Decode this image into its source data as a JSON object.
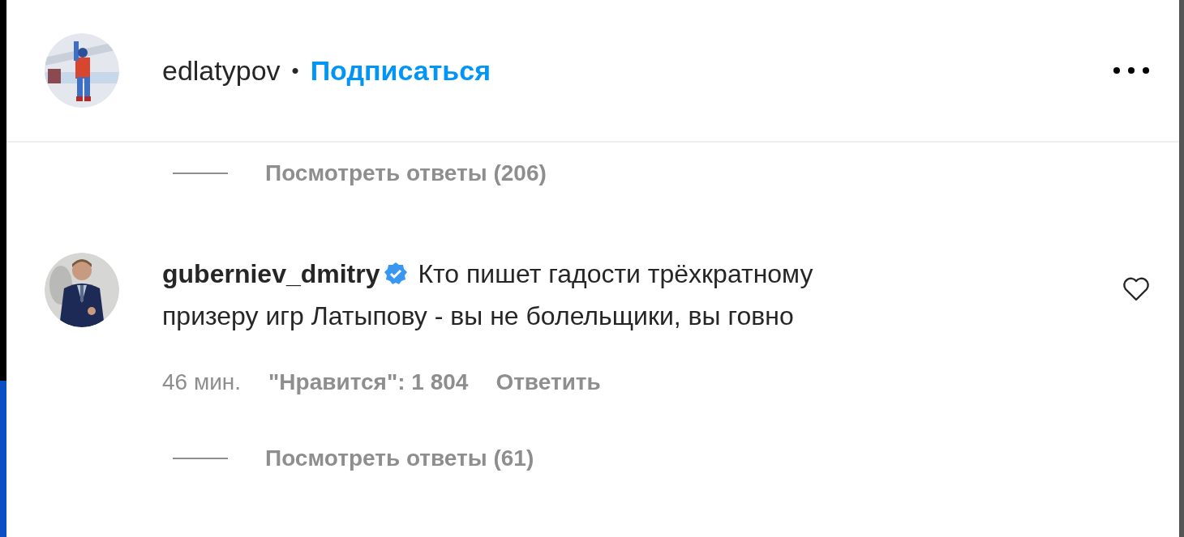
{
  "post_header": {
    "username": "edlatypov",
    "separator": "•",
    "follow": "Подписаться"
  },
  "comments": [
    {
      "kind": "replies",
      "label": "Посмотреть ответы (206)"
    },
    {
      "kind": "comment",
      "username": "guberniev_dmitry",
      "verified": true,
      "text": "Кто пишет гадости трёхкратному призеру игр Латыпову - вы не болельщики, вы говно",
      "time": "46 мин.",
      "likes": "\"Нравится\": 1 804",
      "reply": "Ответить",
      "liked": false
    },
    {
      "kind": "replies",
      "label": "Посмотреть ответы (61)"
    }
  ]
}
